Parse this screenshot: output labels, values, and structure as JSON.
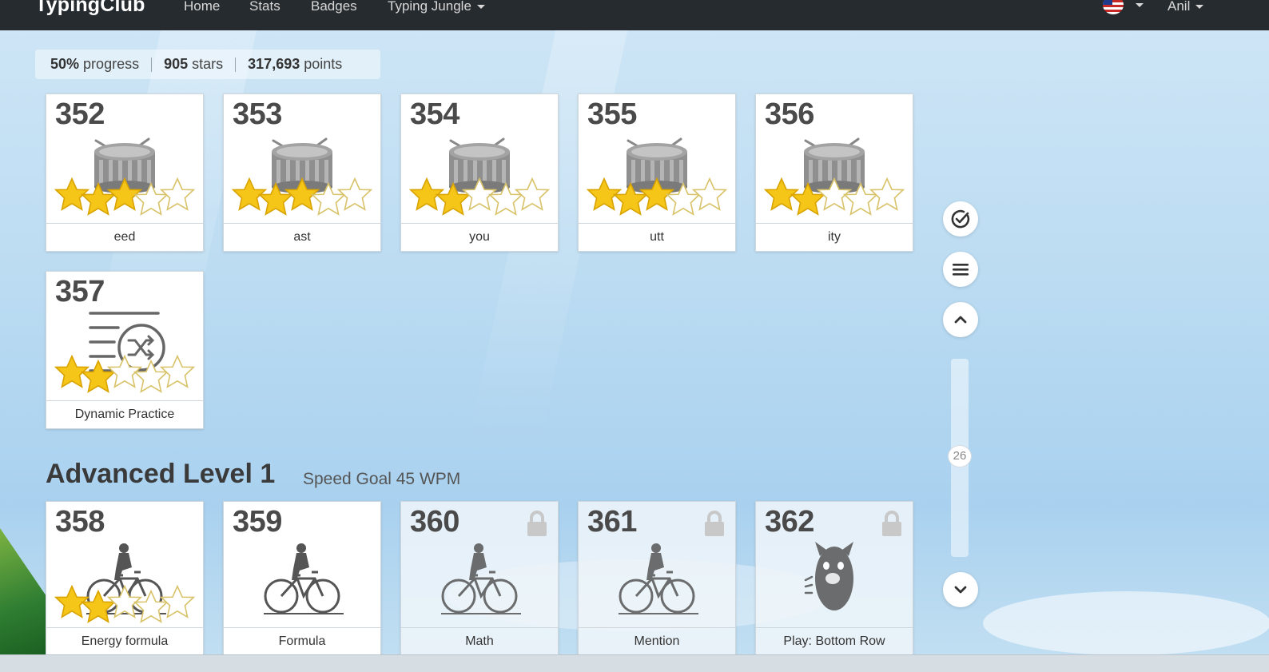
{
  "nav": {
    "brand": "TypingClub",
    "links": [
      "Home",
      "Stats",
      "Badges",
      "Typing Jungle"
    ],
    "user": "Anil"
  },
  "progress": {
    "percent": "50%",
    "percent_label": "progress",
    "stars": "905",
    "stars_label": "stars",
    "points": "317,693",
    "points_label": "points"
  },
  "lessons": [
    {
      "num": "352",
      "label": "eed",
      "stars": 3,
      "icon": "drum-icon",
      "locked": false
    },
    {
      "num": "353",
      "label": "ast",
      "stars": 3,
      "icon": "drum-icon",
      "locked": false
    },
    {
      "num": "354",
      "label": "you",
      "stars": 2,
      "icon": "drum-icon",
      "locked": false
    },
    {
      "num": "355",
      "label": "utt",
      "stars": 3,
      "icon": "drum-icon",
      "locked": false
    },
    {
      "num": "356",
      "label": "ity",
      "stars": 2,
      "icon": "drum-icon",
      "locked": false
    },
    {
      "num": "357",
      "label": "Dynamic Practice",
      "stars": 2,
      "icon": "shuffle-list-icon",
      "locked": false
    }
  ],
  "level": {
    "title": "Advanced Level 1",
    "subtitle": "Speed Goal 45 WPM"
  },
  "level_lessons": [
    {
      "num": "358",
      "label": "Energy formula",
      "stars": 2,
      "icon": "bicycle-icon",
      "locked": false
    },
    {
      "num": "359",
      "label": "Formula",
      "stars": 0,
      "icon": "bicycle-icon",
      "locked": false
    },
    {
      "num": "360",
      "label": "Math",
      "stars": 0,
      "icon": "bicycle-icon",
      "locked": true
    },
    {
      "num": "361",
      "label": "Mention",
      "stars": 0,
      "icon": "bicycle-icon",
      "locked": true
    },
    {
      "num": "362",
      "label": "Play: Bottom Row",
      "stars": 0,
      "icon": "monster-icon",
      "locked": true
    }
  ],
  "scroll": {
    "position_label": "26"
  },
  "colors": {
    "star_fill": "#f5c518",
    "navbar": "#262b2f",
    "card_text": "#4a4a4a"
  }
}
